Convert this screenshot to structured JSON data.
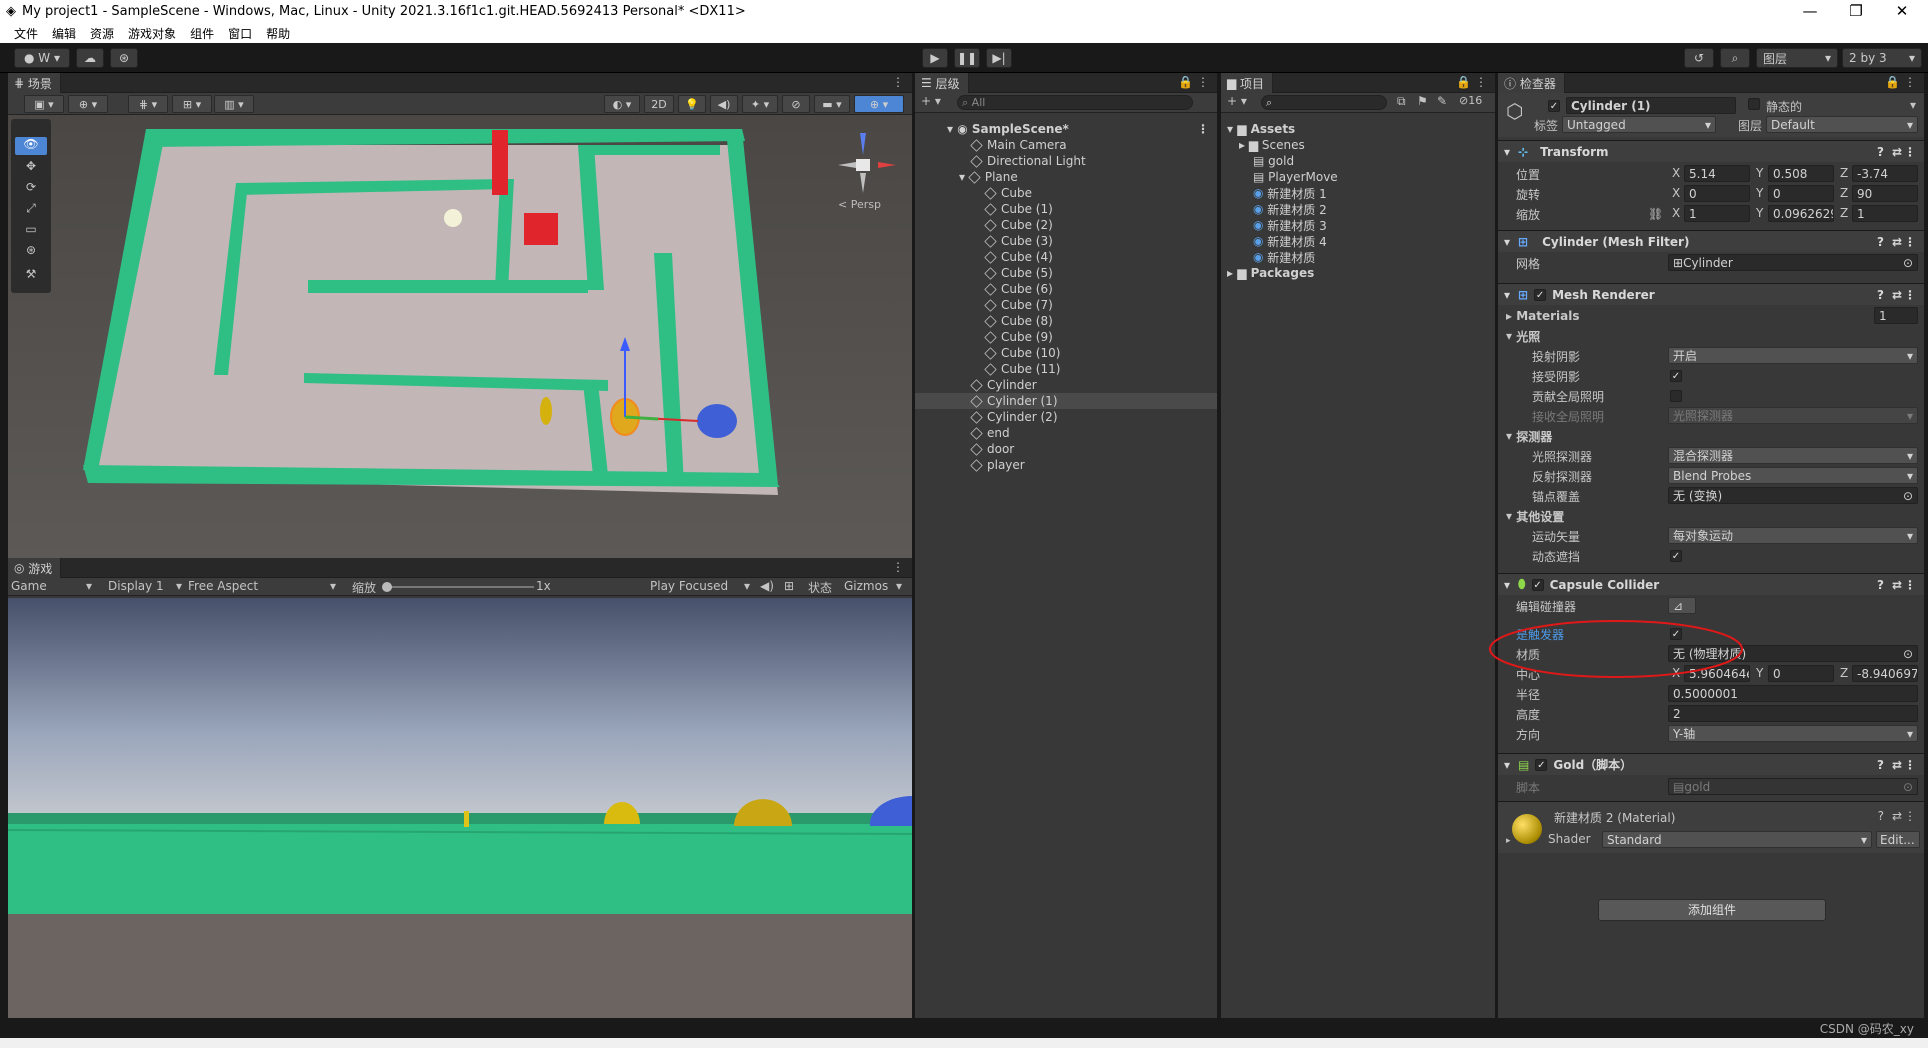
{
  "window": {
    "title": "My project1 - SampleScene - Windows, Mac, Linux - Unity 2021.3.16f1c1.git.HEAD.5692413 Personal* <DX11>"
  },
  "menu": [
    "文件",
    "编辑",
    "资源",
    "游戏对象",
    "组件",
    "窗口",
    "帮助"
  ],
  "toolbar": {
    "account": "W",
    "layers": "图层",
    "layout": "2 by 3"
  },
  "scene": {
    "tab": "场景",
    "mode_2d": "2D",
    "persp": "< Persp"
  },
  "game": {
    "tab": "游戏",
    "display_mode": "Game",
    "display": "Display 1",
    "aspect": "Free Aspect",
    "scale_label": "缩放",
    "scale_value": "1x",
    "play_focused": "Play Focused",
    "stats": "状态",
    "gizmos": "Gizmos"
  },
  "hierarchy": {
    "tab": "层级",
    "search": "All",
    "scene": "SampleScene*",
    "items": [
      "Main Camera",
      "Directional Light",
      "Plane",
      "Cube",
      "Cube (1)",
      "Cube (2)",
      "Cube (3)",
      "Cube (4)",
      "Cube (5)",
      "Cube (6)",
      "Cube (7)",
      "Cube (8)",
      "Cube (9)",
      "Cube (10)",
      "Cube (11)",
      "Cylinder",
      "Cylinder (1)",
      "Cylinder (2)",
      "end",
      "door",
      "player"
    ]
  },
  "project": {
    "tab": "项目",
    "count": "16",
    "items": [
      "Assets",
      "Scenes",
      "gold",
      "PlayerMove",
      "新建材质 1",
      "新建材质 2",
      "新建材质 3",
      "新建材质 4",
      "新建材质",
      "Packages"
    ]
  },
  "inspector": {
    "tab": "检查器",
    "object_name": "Cylinder (1)",
    "static": "静态的",
    "tag_label": "标签",
    "tag": "Untagged",
    "layer_label": "图层",
    "layer": "Default",
    "transform": {
      "title": "Transform",
      "pos_label": "位置",
      "rot_label": "旋转",
      "scale_label": "缩放",
      "pos": [
        "5.14",
        "0.508",
        "-3.74"
      ],
      "rot": [
        "0",
        "0",
        "90"
      ],
      "scale": [
        "1",
        "0.0962629",
        "1"
      ]
    },
    "mesh_filter": {
      "title": "Cylinder (Mesh Filter)",
      "mesh_label": "网格",
      "mesh": "Cylinder"
    },
    "mesh_renderer": {
      "title": "Mesh Renderer",
      "materials": "Materials",
      "materials_count": "1",
      "lighting": "光照",
      "cast_shadows_label": "投射阴影",
      "cast_shadows": "开启",
      "receive_shadows": "接受阴影",
      "contribute_gi": "贡献全局照明",
      "receive_gi_label": "接收全局照明",
      "receive_gi": "光照探测器",
      "probes": "探测器",
      "light_probes_label": "光照探测器",
      "light_probes": "混合探测器",
      "reflection_probes_label": "反射探测器",
      "reflection_probes": "Blend Probes",
      "anchor_label": "锚点覆盖",
      "anchor": "无 (变换)",
      "other": "其他设置",
      "motion_label": "运动矢量",
      "motion": "每对象运动",
      "dynamic_occlusion": "动态遮挡"
    },
    "capsule": {
      "title": "Capsule Collider",
      "edit_label": "编辑碰撞器",
      "trigger_label": "是触发器",
      "material_label": "材质",
      "material": "无 (物理材质)",
      "center_label": "中心",
      "center": [
        "5.960464e",
        "0",
        "-8.940697e"
      ],
      "radius_label": "半径",
      "radius": "0.5000001",
      "height_label": "高度",
      "height": "2",
      "direction_label": "方向",
      "direction": "Y-轴"
    },
    "script": {
      "title": "Gold（脚本）",
      "script_label": "脚本",
      "script": "gold"
    },
    "material": {
      "name": "新建材质 2 (Material)",
      "shader_label": "Shader",
      "shader": "Standard",
      "edit": "Edit..."
    },
    "add_component": "添加组件"
  },
  "watermark": "CSDN @码农_xy",
  "colors": {
    "wall": "#2fbf84",
    "floor": "#c2b6b6",
    "accent": "#4d86d4"
  }
}
